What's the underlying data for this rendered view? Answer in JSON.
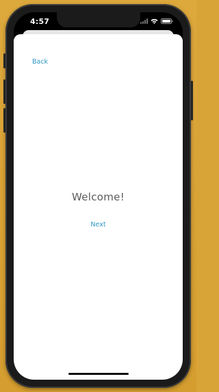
{
  "status_bar": {
    "time": "4:57"
  },
  "navigation": {
    "back_label": "Back"
  },
  "main": {
    "title": "Welcome!",
    "next_label": "Next"
  },
  "colors": {
    "background": "#d9a437",
    "link": "#2e97c2",
    "title": "#5b5b5b"
  },
  "icons": [
    "signal-icon",
    "wifi-icon",
    "battery-icon"
  ]
}
